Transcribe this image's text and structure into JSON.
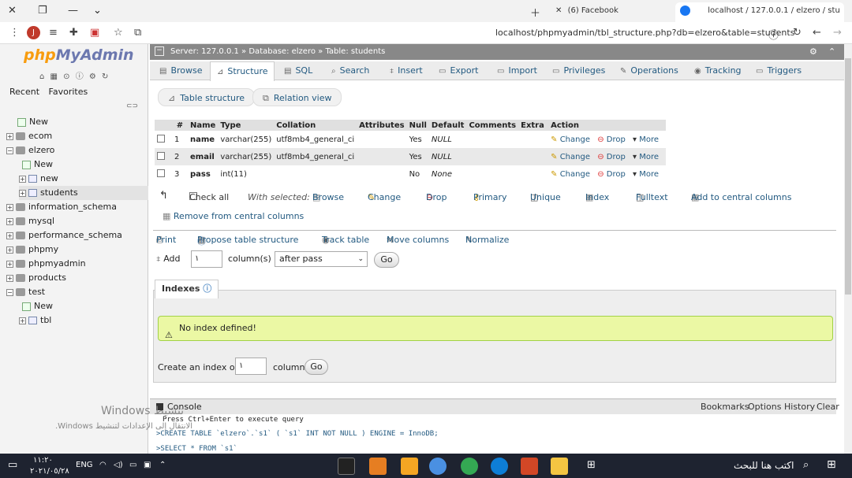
{
  "browser": {
    "tabs": [
      {
        "label": "(6) Facebook"
      },
      {
        "label": "localhost / 127.0.0.1 / elzero / stu"
      }
    ],
    "url": "localhost/phpmyadmin/tbl_structure.php?db=elzero&table=students",
    "avatar_letter": "J"
  },
  "sidebar": {
    "logo_php": "php",
    "logo_rest": "MyAdmin",
    "tabs": [
      "Recent",
      "Favorites"
    ],
    "items": [
      {
        "label": "New"
      },
      {
        "label": "ecom"
      },
      {
        "label": "elzero"
      },
      {
        "label": "New"
      },
      {
        "label": "new"
      },
      {
        "label": "students"
      },
      {
        "label": "information_schema"
      },
      {
        "label": "mysql"
      },
      {
        "label": "performance_schema"
      },
      {
        "label": "phpmy"
      },
      {
        "label": "phpmyadmin"
      },
      {
        "label": "products"
      },
      {
        "label": "test"
      },
      {
        "label": "New"
      },
      {
        "label": "tbl"
      }
    ]
  },
  "breadcrumb": {
    "server": "Server: 127.0.0.1 »",
    "database": "Database: elzero »",
    "table": "Table: students"
  },
  "menu": [
    "Browse",
    "Structure",
    "SQL",
    "Search",
    "Insert",
    "Export",
    "Import",
    "Privileges",
    "Operations",
    "Tracking",
    "Triggers"
  ],
  "subtabs": [
    "Table structure",
    "Relation view"
  ],
  "structure": {
    "headers": [
      "#",
      "Name",
      "Type",
      "Collation",
      "Attributes",
      "Null",
      "Default",
      "Comments",
      "Extra",
      "Action"
    ],
    "rows": [
      {
        "num": "1",
        "name": "name",
        "type": "varchar(255)",
        "collation": "utf8mb4_general_ci",
        "null": "Yes",
        "default": "NULL"
      },
      {
        "num": "2",
        "name": "email",
        "type": "varchar(255)",
        "collation": "utf8mb4_general_ci",
        "null": "Yes",
        "default": "NULL"
      },
      {
        "num": "3",
        "name": "pass",
        "type": "int(11)",
        "collation": "",
        "null": "No",
        "default": "None"
      }
    ],
    "actions": {
      "change": "Change",
      "drop": "Drop",
      "more": "More"
    }
  },
  "row_tools": {
    "check_all": "Check all",
    "with_selected": "With selected:",
    "browse": "Browse",
    "change": "Change",
    "drop": "Drop",
    "primary": "Primary",
    "unique": "Unique",
    "index": "Index",
    "fulltext": "Fulltext",
    "central": "Add to central columns",
    "remove_central": "Remove from central columns"
  },
  "tools2": {
    "print": "Print",
    "propose": "Propose table structure",
    "track": "Track table",
    "move": "Move columns",
    "normalize": "Normalize"
  },
  "add_row": {
    "add": "Add",
    "count": "١",
    "columns": "column(s)",
    "position": "after pass",
    "go": "Go"
  },
  "indexes": {
    "tab": "Indexes",
    "notice": "No index defined!",
    "create_label": "Create an index on",
    "count": "١",
    "columns": "columns",
    "go": "Go"
  },
  "console": {
    "title": "Console",
    "links": [
      "Bookmarks",
      "Options",
      "History",
      "Clear"
    ],
    "lines": [
      "Press Ctrl+Enter to execute query",
      ">CREATE TABLE `elzero`.`s1` ( `s1` INT NOT NULL ) ENGINE = InnoDB;",
      ">SELECT * FROM `s1`"
    ]
  },
  "watermark": {
    "line1": "Windows تنشيط",
    "line2": ".Windows الانتقال إلى الإعدادات لتنشيط"
  },
  "taskbar": {
    "time": "١١:٢٠",
    "date": "٢٠٢١/٠٥/٢٨",
    "lang": "ENG",
    "search": "اكتب هنا للبحث"
  },
  "colors": {
    "link": "#235a81",
    "logo_blue": "#6c78af",
    "logo_orange": "#f89c0e",
    "notice_bg": "#ebf8a4"
  }
}
